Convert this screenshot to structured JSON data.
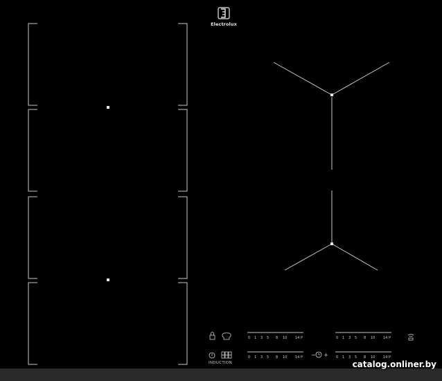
{
  "brand": {
    "name": "Electrolux",
    "logo_icon": "electrolux-logo-icon"
  },
  "control_panel": {
    "induction_label": "INDUCTION",
    "slider_scale": [
      "0",
      "1",
      "3",
      "5",
      "8",
      "10",
      "14",
      "P"
    ],
    "timer_minus": "−",
    "timer_plus": "+",
    "icons": [
      "lock-icon",
      "chef-hat-icon",
      "power-icon",
      "display-icon",
      "timer-icon",
      "wifi-icon"
    ]
  },
  "watermark": "catalog.onliner.by"
}
